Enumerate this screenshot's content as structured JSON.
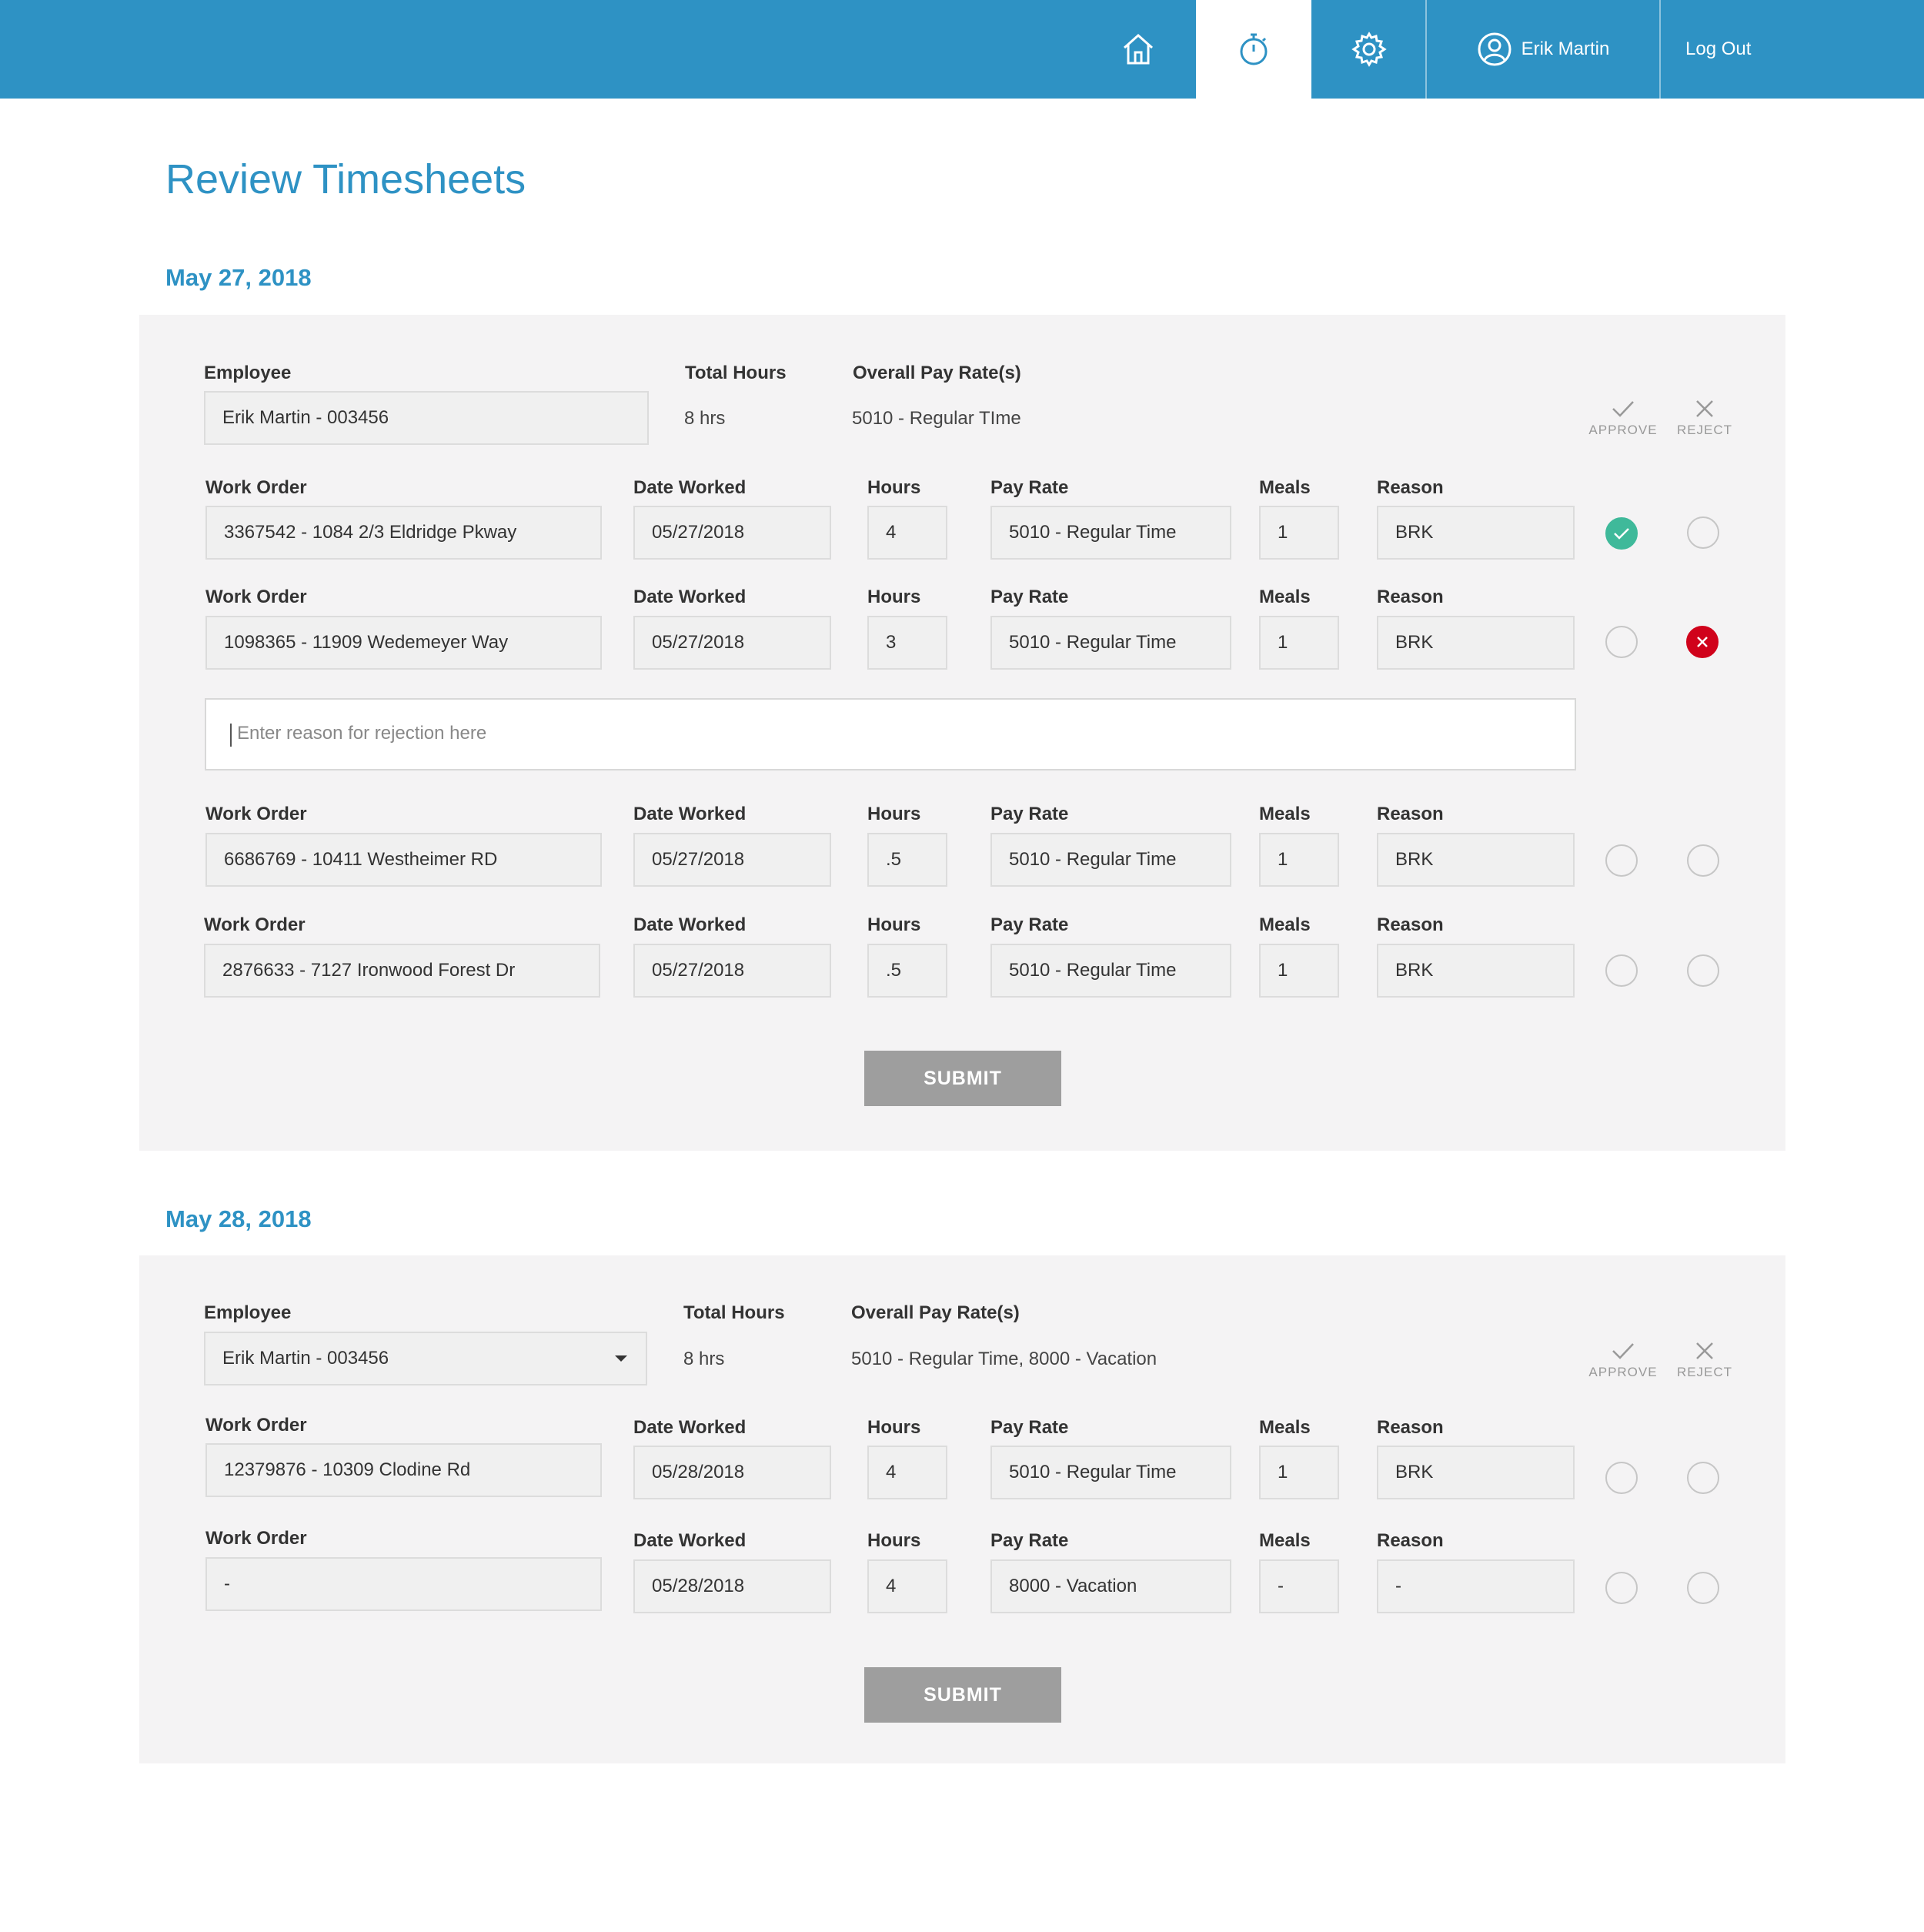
{
  "nav": {
    "user_name": "Erik Martin",
    "logout_label": "Log Out"
  },
  "page": {
    "title": "Review Timesheets"
  },
  "labels": {
    "employee": "Employee",
    "total_hours": "Total Hours",
    "overall_pay_rates": "Overall Pay Rate(s)",
    "work_order": "Work Order",
    "date_worked": "Date Worked",
    "hours": "Hours",
    "pay_rate": "Pay Rate",
    "meals": "Meals",
    "reason": "Reason",
    "approve": "APPROVE",
    "reject": "REJECT",
    "submit": "SUBMIT"
  },
  "sections": [
    {
      "date": "May 27, 2018",
      "employee": "Erik Martin - 003456",
      "total_hours": "8 hrs",
      "overall_pay_rates": "5010 - Regular TIme",
      "rows": [
        {
          "work_order": "3367542 - 1084 2/3 Eldridge Pkway",
          "date_worked": "05/27/2018",
          "hours": "4",
          "pay_rate": "5010 - Regular Time",
          "meals": "1",
          "reason": "BRK",
          "status": "approved"
        },
        {
          "work_order": "1098365 - 11909 Wedemeyer Way",
          "date_worked": "05/27/2018",
          "hours": "3",
          "pay_rate": "5010 - Regular Time",
          "meals": "1",
          "reason": "BRK",
          "status": "rejected"
        },
        {
          "work_order": "6686769 - 10411 Westheimer RD",
          "date_worked": "05/27/2018",
          "hours": ".5",
          "pay_rate": "5010 - Regular Time",
          "meals": "1",
          "reason": "BRK",
          "status": "none"
        },
        {
          "work_order": "2876633 - 7127 Ironwood Forest Dr",
          "date_worked": "05/27/2018",
          "hours": ".5",
          "pay_rate": "5010 - Regular Time",
          "meals": "1",
          "reason": "BRK",
          "status": "none"
        }
      ],
      "rejection_placeholder": "Enter reason for rejection here"
    },
    {
      "date": "May 28, 2018",
      "employee": "Erik Martin - 003456",
      "total_hours": "8 hrs",
      "overall_pay_rates": "5010 - Regular Time, 8000 - Vacation",
      "rows": [
        {
          "work_order": "12379876 - 10309 Clodine Rd",
          "date_worked": "05/28/2018",
          "hours": "4",
          "pay_rate": "5010 - Regular Time",
          "meals": "1",
          "reason": "BRK",
          "status": "none"
        },
        {
          "work_order": "-",
          "date_worked": "05/28/2018",
          "hours": "4",
          "pay_rate": "8000 - Vacation",
          "meals": "-",
          "reason": "-",
          "status": "none"
        }
      ]
    }
  ],
  "colors": {
    "brand": "#2e92c4",
    "approve": "#3fb99a",
    "reject": "#d0021b",
    "submit": "#9e9e9e",
    "card_bg": "#f4f3f4"
  },
  "icons": [
    "home-icon",
    "stopwatch-icon",
    "gear-icon",
    "user-icon",
    "check-icon",
    "close-icon"
  ]
}
